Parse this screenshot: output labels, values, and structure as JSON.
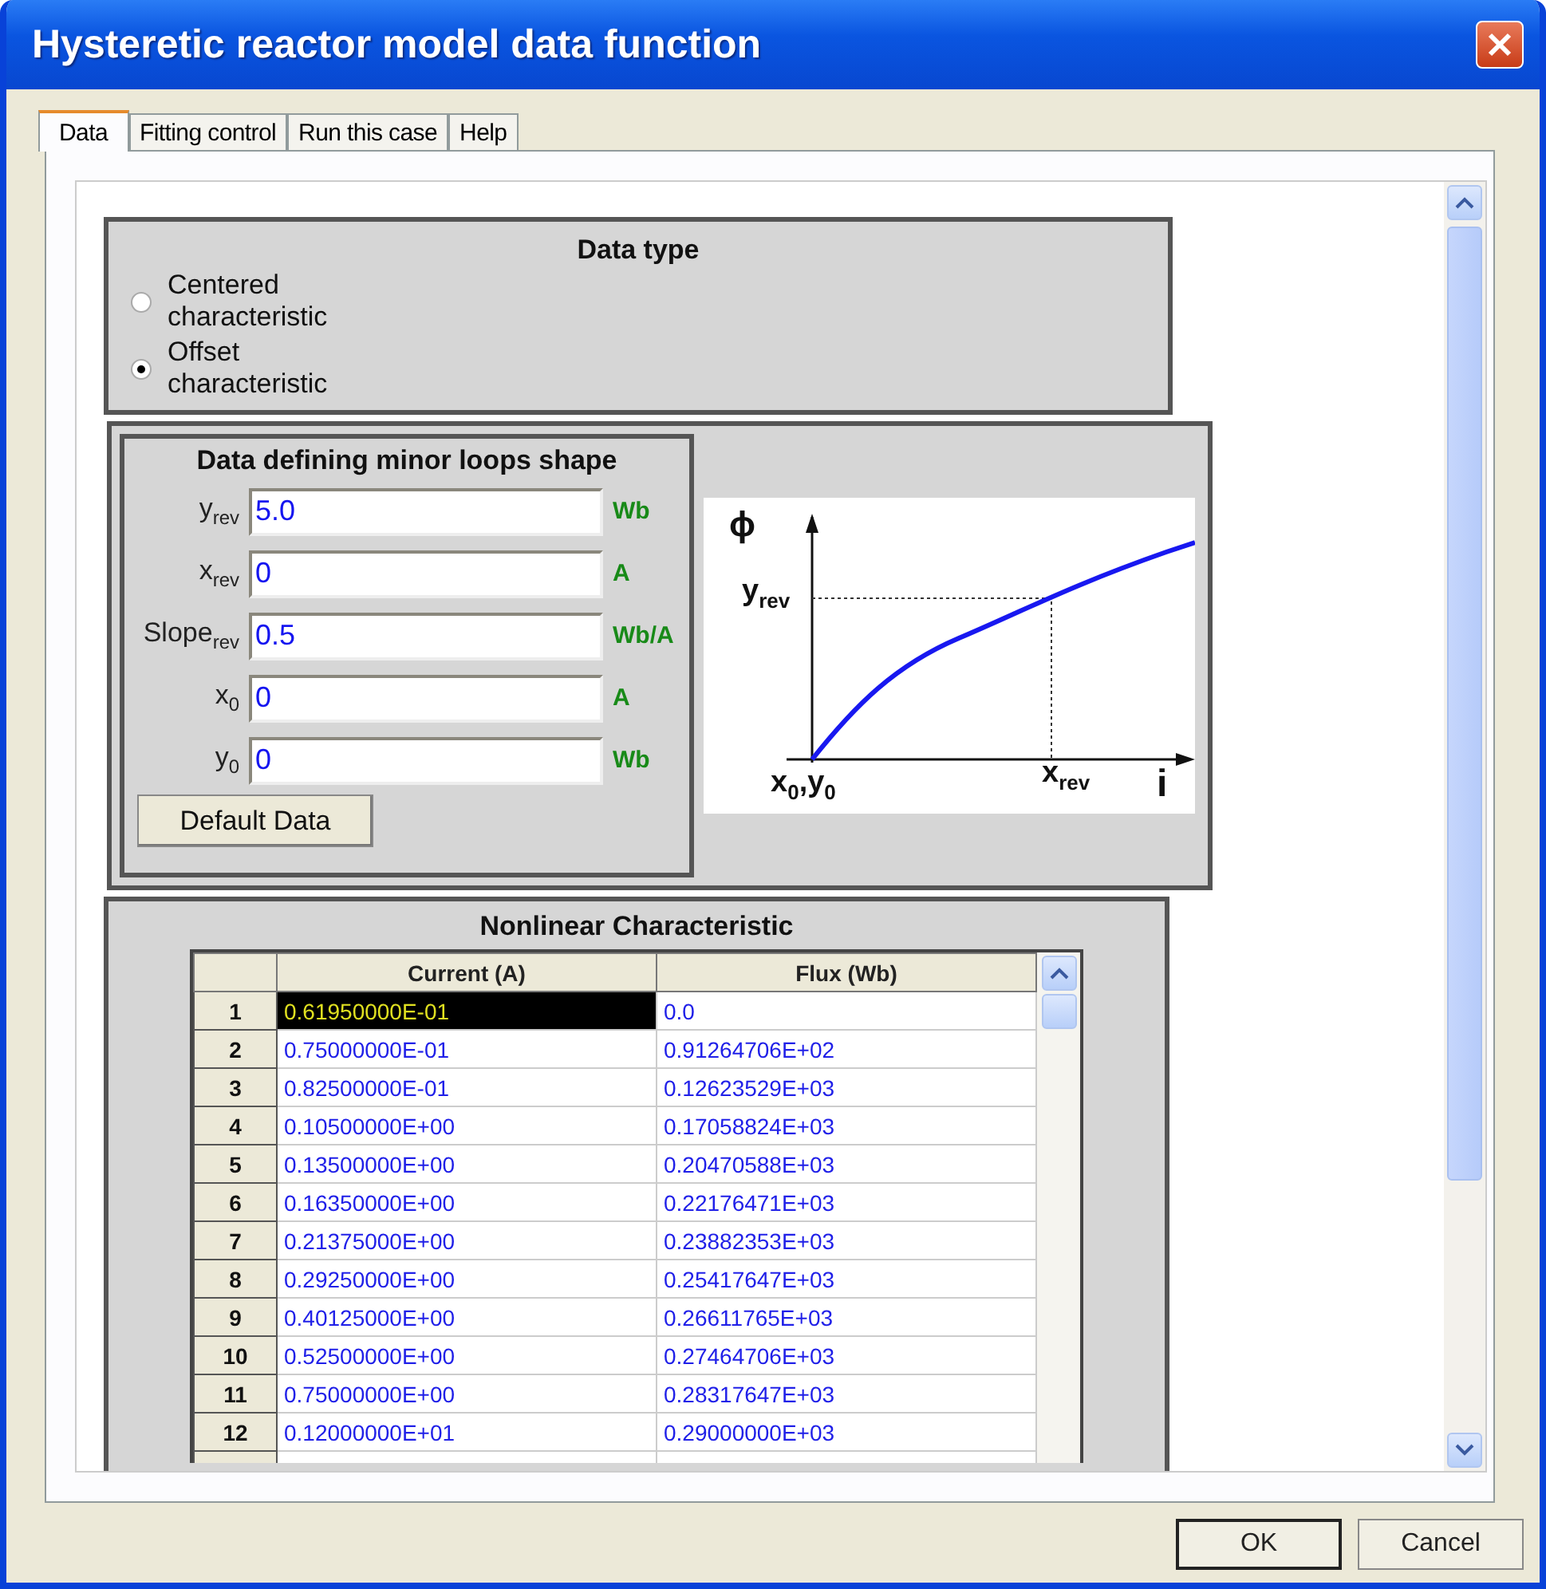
{
  "window": {
    "title": "Hysteretic reactor model data function"
  },
  "tabs": [
    {
      "label": "Data",
      "selected": true
    },
    {
      "label": "Fitting control",
      "selected": false
    },
    {
      "label": "Run this case",
      "selected": false
    },
    {
      "label": "Help",
      "selected": false
    }
  ],
  "data_type": {
    "title": "Data type",
    "options": [
      {
        "label": "Centered characteristic",
        "selected": false
      },
      {
        "label": "Offset characteristic",
        "selected": true
      }
    ]
  },
  "minor_loops": {
    "title": "Data defining minor loops shape",
    "fields": [
      {
        "label": "y$_{rev}$",
        "value": "5.0",
        "unit": "Wb"
      },
      {
        "label": "x$_{rev}$",
        "value": "0",
        "unit": "A"
      },
      {
        "label": "Slope$_{rev}$",
        "value": "0.5",
        "unit": "Wb/A"
      },
      {
        "label": "x$_{0}$",
        "value": "0",
        "unit": "A"
      },
      {
        "label": "y$_{0}$",
        "value": "0",
        "unit": "Wb"
      }
    ],
    "default_button": "Default Data",
    "diagram_labels": [
      {
        "kind": "y-axis",
        "text": "ϕ"
      },
      {
        "kind": "y-mark",
        "text": "y$_{rev}$"
      },
      {
        "kind": "origin",
        "text": "x$_{0}$,y$_{0}$"
      },
      {
        "kind": "x-mark",
        "text": "x$_{rev}$"
      },
      {
        "kind": "x-axis",
        "text": "i"
      }
    ]
  },
  "nonlinear": {
    "title": "Nonlinear Characteristic",
    "columns": [
      "Current (A)",
      "Flux (Wb)"
    ],
    "rows": [
      {
        "index": "1",
        "current": "0.61950000E-01",
        "flux": "0.0",
        "selected": true
      },
      {
        "index": "2",
        "current": "0.75000000E-01",
        "flux": "0.91264706E+02",
        "selected": false
      },
      {
        "index": "3",
        "current": "0.82500000E-01",
        "flux": "0.12623529E+03",
        "selected": false
      },
      {
        "index": "4",
        "current": "0.10500000E+00",
        "flux": "0.17058824E+03",
        "selected": false
      },
      {
        "index": "5",
        "current": "0.13500000E+00",
        "flux": "0.20470588E+03",
        "selected": false
      },
      {
        "index": "6",
        "current": "0.16350000E+00",
        "flux": "0.22176471E+03",
        "selected": false
      },
      {
        "index": "7",
        "current": "0.21375000E+00",
        "flux": "0.23882353E+03",
        "selected": false
      },
      {
        "index": "8",
        "current": "0.29250000E+00",
        "flux": "0.25417647E+03",
        "selected": false
      },
      {
        "index": "9",
        "current": "0.40125000E+00",
        "flux": "0.26611765E+03",
        "selected": false
      },
      {
        "index": "10",
        "current": "0.52500000E+00",
        "flux": "0.27464706E+03",
        "selected": false
      },
      {
        "index": "11",
        "current": "0.75000000E+00",
        "flux": "0.28317647E+03",
        "selected": false
      },
      {
        "index": "12",
        "current": "0.12000000E+01",
        "flux": "0.29000000E+03",
        "selected": false
      }
    ]
  },
  "buttons": [
    "OK",
    "Cancel"
  ]
}
